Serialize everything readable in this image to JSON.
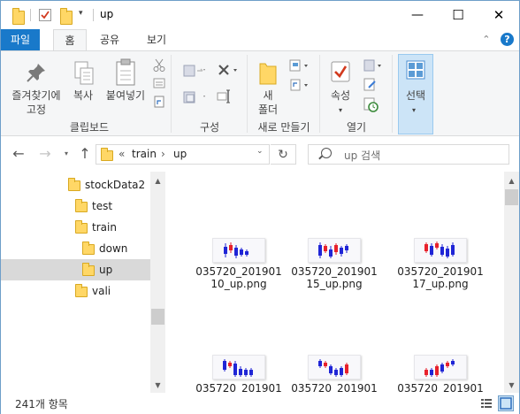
{
  "window": {
    "title": "up",
    "controls": {
      "minimize": "—",
      "maximize": "☐",
      "close": "✕"
    }
  },
  "ribbon_tabs": [
    "파일",
    "홈",
    "공유",
    "보기"
  ],
  "ribbon": {
    "clipboard": {
      "pin": "즐겨찾기에\n고정",
      "pin_line1": "즐겨찾기에",
      "pin_line2": "고정",
      "copy": "복사",
      "paste": "붙여넣기",
      "group": "클립보드"
    },
    "organize": {
      "group": "구성"
    },
    "new": {
      "new_folder_line1": "새",
      "new_folder_line2": "폴더",
      "group": "새로 만들기"
    },
    "open": {
      "properties": "속성",
      "group": "열기"
    },
    "select": {
      "select": "선택"
    }
  },
  "address": {
    "overflow": "«",
    "segments": [
      "train",
      "up"
    ],
    "separator": "›"
  },
  "search": {
    "placeholder": "up 검색"
  },
  "tree": [
    {
      "label": "stockData2",
      "indent": 0
    },
    {
      "label": "test",
      "indent": 1
    },
    {
      "label": "train",
      "indent": 1
    },
    {
      "label": "down",
      "indent": 2
    },
    {
      "label": "up",
      "indent": 2,
      "selected": true
    },
    {
      "label": "vali",
      "indent": 1
    }
  ],
  "files": [
    {
      "line1": "035720_201901",
      "line2": "10_up.png"
    },
    {
      "line1": "035720_201901",
      "line2": "15_up.png"
    },
    {
      "line1": "035720_201901",
      "line2": "17_up.png"
    },
    {
      "line1": "035720_201901",
      "line2": ""
    },
    {
      "line1": "035720_201901",
      "line2": ""
    },
    {
      "line1": "035720_201901",
      "line2": ""
    }
  ],
  "status": {
    "count": "241개 항목"
  },
  "colors": {
    "accent": "#1979ca",
    "folder": "#ffd766",
    "candle_up": "#e8212b",
    "candle_down": "#1f25d6"
  }
}
